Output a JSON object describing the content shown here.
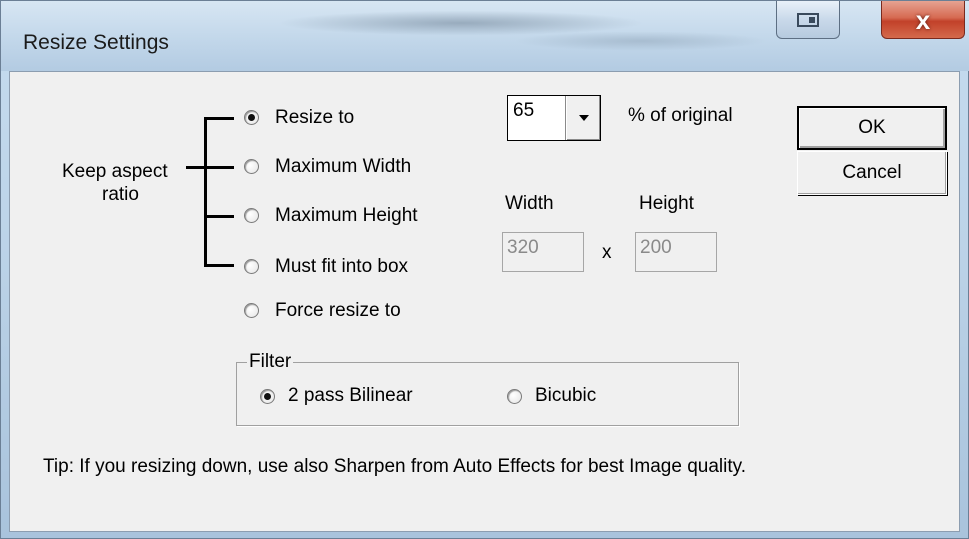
{
  "window": {
    "title": "Resize Settings",
    "close_symbol": "x",
    "restore_icon": "restore-icon",
    "close_icon": "close-icon"
  },
  "keep_aspect": {
    "label_line1": "Keep aspect",
    "label_line2": "ratio"
  },
  "resize_modes": [
    {
      "label": "Resize to",
      "checked": true
    },
    {
      "label": "Maximum Width",
      "checked": false
    },
    {
      "label": "Maximum Height",
      "checked": false
    },
    {
      "label": "Must fit into box",
      "checked": false
    },
    {
      "label": "Force resize to",
      "checked": false
    }
  ],
  "percent": {
    "value": "65",
    "suffix": "% of original"
  },
  "size": {
    "width_label": "Width",
    "height_label": "Height",
    "width_value": "320",
    "height_value": "200",
    "separator": "x"
  },
  "buttons": {
    "ok": "OK",
    "cancel": "Cancel"
  },
  "filter": {
    "legend": "Filter",
    "options": [
      {
        "label": "2 pass Bilinear",
        "checked": true
      },
      {
        "label": "Bicubic",
        "checked": false
      }
    ]
  },
  "tip": "Tip: If you resizing down, use also Sharpen from Auto Effects for best Image quality."
}
